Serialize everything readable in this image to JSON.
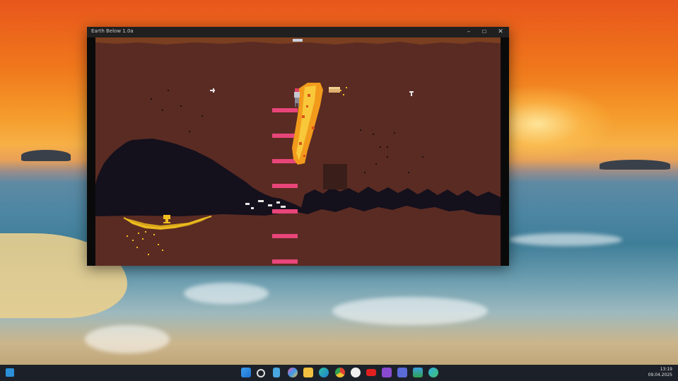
{
  "window": {
    "title": "Earth Below 1.0a",
    "minimize_label": "–",
    "maximize_label": "☐",
    "close_label": "✕"
  },
  "taskbar": {
    "time": "13:19",
    "date": "09.04.2025",
    "icons": [
      "widgets-icon",
      "start-icon",
      "search-icon",
      "notepad-icon",
      "copilot-icon",
      "file-explorer-icon",
      "edge-icon",
      "chrome-icon",
      "yandex-icon",
      "youtube-icon",
      "visual-studio-icon",
      "save-icon",
      "game-icon",
      "globe-icon"
    ]
  },
  "colors": {
    "cave_dirt": "#5a2b23",
    "cave_dark": "#14101c",
    "ladder_pink": "#e8457a",
    "fire_orange": "#f29a1c",
    "gold": "#f0c020"
  }
}
